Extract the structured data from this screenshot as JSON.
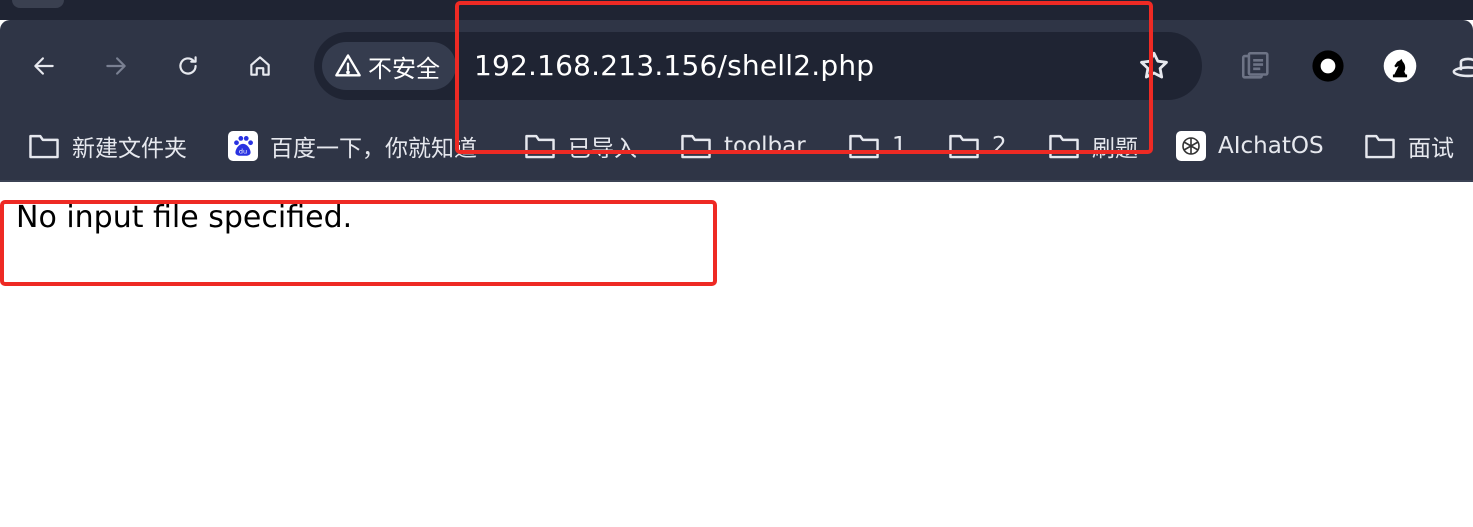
{
  "browser": {
    "omnibox": {
      "security_label": "不安全",
      "url": "192.168.213.156/shell2.php"
    },
    "nav": {
      "back_icon": "arrow-left-icon",
      "forward_icon": "arrow-right-icon",
      "reload_icon": "reload-icon",
      "home_icon": "home-icon"
    },
    "extensions": [
      "document-icon",
      "circle-extension-icon",
      "chess-knight-icon",
      "hat-icon"
    ]
  },
  "bookmarks": [
    {
      "label": "新建文件夹",
      "icon": "folder-icon"
    },
    {
      "label": "百度一下，你就知道",
      "icon": "baidu-icon"
    },
    {
      "label": "已导入",
      "icon": "folder-icon"
    },
    {
      "label": "toolbar",
      "icon": "folder-icon"
    },
    {
      "label": "1",
      "icon": "folder-icon"
    },
    {
      "label": "2",
      "icon": "folder-icon"
    },
    {
      "label": "刷题",
      "icon": "folder-icon"
    },
    {
      "label": "AIchatOS",
      "icon": "openai-icon"
    },
    {
      "label": "面试",
      "icon": "folder-icon"
    }
  ],
  "page": {
    "message": "No input file specified."
  },
  "colors": {
    "chrome_bg": "#2f3546",
    "omnibox_bg": "#1f2433",
    "annotation": "#ee2a24"
  }
}
